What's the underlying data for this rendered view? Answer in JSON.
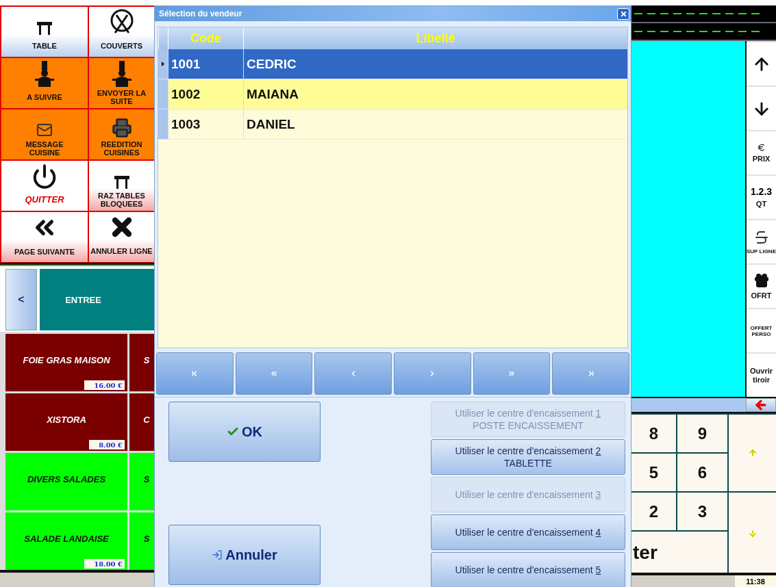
{
  "left_panel": {
    "function_buttons": [
      {
        "label": "TABLE",
        "kind": "table",
        "color": "#b9d0ee"
      },
      {
        "label": "COUVERTS",
        "kind": "cutlery",
        "color": "#b9d0ee"
      },
      {
        "label": "A SUIVRE",
        "kind": "chef",
        "color": "#ff7f00"
      },
      {
        "label": "ENVOYER LA SUITE",
        "kind": "chef",
        "color": "#ff7f00"
      },
      {
        "label": "MESSAGE CUISINE",
        "kind": "message",
        "color": "#ff7f00"
      },
      {
        "label": "REEDITION CUISINES",
        "kind": "printer",
        "color": "#ff7f00"
      },
      {
        "label": "QUITTER",
        "kind": "power",
        "color": "#ffffff"
      },
      {
        "label": "RAZ TABLES BLOQUEES",
        "kind": "table",
        "color": "#f4a7a7"
      },
      {
        "label": "PAGE SUIVANTE",
        "kind": "double-chevron",
        "color": "#f4a7a7"
      },
      {
        "label": "ANNULER LIGNE",
        "kind": "cross",
        "color": "#f4a7a7"
      }
    ],
    "category_nav": {
      "back": "<",
      "category": "ENTREE"
    },
    "products": [
      {
        "name": "FOIE GRAS MAISON",
        "price": "16.00 €",
        "color": "#7a0000"
      },
      {
        "name": "S",
        "color": "#7a0000"
      },
      {
        "name": "XISTORA",
        "price": "8.00 €",
        "color": "#7a0000"
      },
      {
        "name": "C",
        "color": "#7a0000"
      },
      {
        "name": "DIVERS SALADES",
        "color": "#00ff00"
      },
      {
        "name": "S",
        "color": "#00ff00"
      },
      {
        "name": "SALADE LANDAISE",
        "price": "18.00 €",
        "color": "#00ff00"
      },
      {
        "name": "S",
        "color": "#00ff00"
      }
    ]
  },
  "dialog": {
    "title": "Sélection du vendeur",
    "columns": [
      "Code",
      "Libellé"
    ],
    "rows": [
      {
        "code": "1001",
        "name": "CEDRIC",
        "selected": true
      },
      {
        "code": "1002",
        "name": "MAIANA",
        "selected": false
      },
      {
        "code": "1003",
        "name": "DANIEL",
        "selected": false
      }
    ],
    "nav_buttons": [
      {
        "kind": "first"
      },
      {
        "kind": "prev-page"
      },
      {
        "kind": "prev"
      },
      {
        "kind": "next"
      },
      {
        "kind": "next-page"
      },
      {
        "kind": "last"
      }
    ],
    "ok": "OK",
    "cancel": "Annuler",
    "centres": [
      {
        "label": "Utiliser le centre d'encaissement",
        "key": "1",
        "sub": "POSTE ENCAISSEMENT",
        "disabled": true
      },
      {
        "label": "Utiliser le centre d'encaissement",
        "key": "2",
        "sub": "TABLETTE",
        "disabled": false
      },
      {
        "label": "Utiliser le centre d'encaissement",
        "key": "3",
        "disabled": true
      },
      {
        "label": "Utiliser le centre d'encaissement",
        "key": "4",
        "disabled": false
      },
      {
        "label": "Utiliser le centre d'encaissement",
        "key": "5",
        "disabled": false
      }
    ]
  },
  "right_panel": {
    "side_buttons": [
      {
        "kind": "up"
      },
      {
        "kind": "down"
      },
      {
        "kind": "price",
        "label": "PRIX"
      },
      {
        "kind": "qty",
        "glyph": "1.2.3",
        "label": "QT"
      },
      {
        "kind": "delete",
        "label": "SUP LIGNE"
      },
      {
        "kind": "gift",
        "label": "OFRT"
      },
      {
        "kind": "text",
        "label": "OFFERT PERSO"
      },
      {
        "kind": "text",
        "label": "Ouvrir tiroir"
      }
    ],
    "keys": [
      "8",
      "9",
      "5",
      "6",
      "2",
      "3"
    ],
    "enter": "ter",
    "time": "11:38"
  }
}
